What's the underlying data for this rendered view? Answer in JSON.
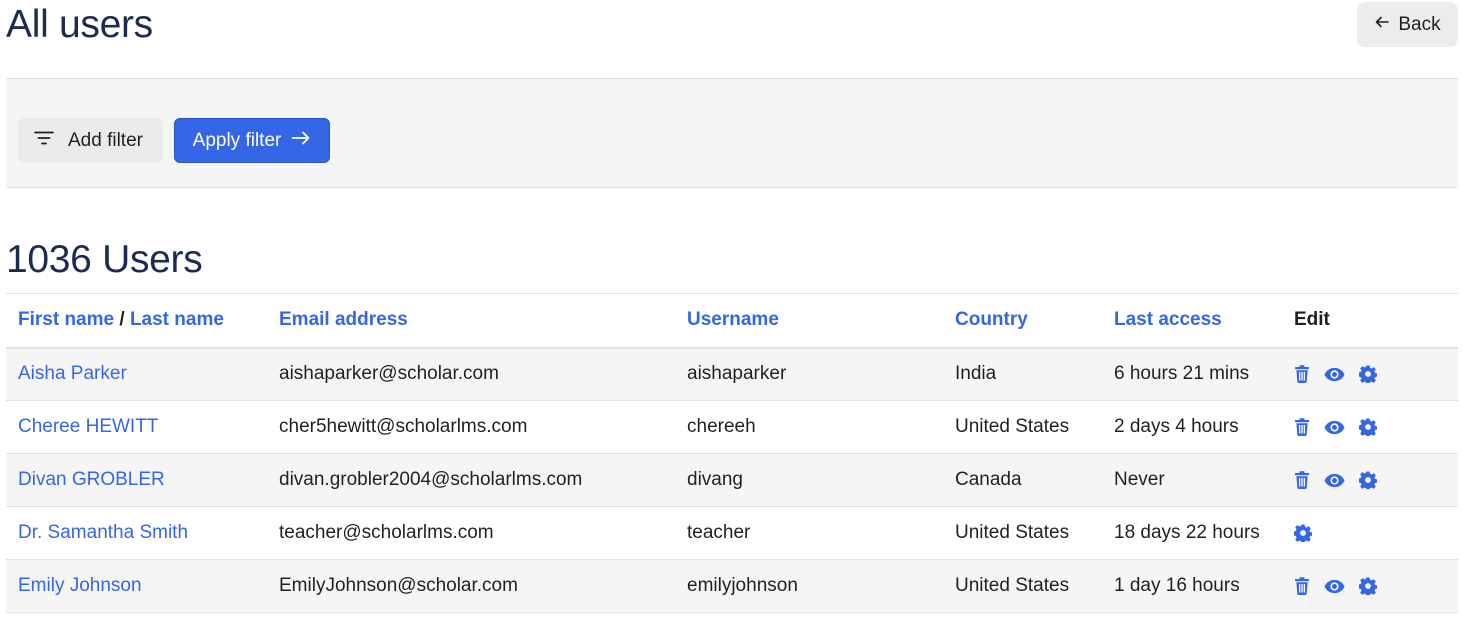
{
  "page_title": "All users",
  "back_label": "Back",
  "filter": {
    "add_label": "Add filter",
    "apply_label": "Apply filter"
  },
  "count_title": "1036 Users",
  "table": {
    "headers": {
      "first_name": "First name",
      "separator": "/",
      "last_name": "Last name",
      "email": "Email address",
      "username": "Username",
      "country": "Country",
      "last_access": "Last access",
      "edit": "Edit"
    },
    "rows": [
      {
        "name": "Aisha Parker",
        "email": "aishaparker@scholar.com",
        "username": "aishaparker",
        "country": "India",
        "last_access": "6 hours 21 mins",
        "actions": [
          "trash-icon",
          "eye-icon",
          "gear-icon"
        ]
      },
      {
        "name": "Cheree HEWITT",
        "email": "cher5hewitt@scholarlms.com",
        "username": "chereeh",
        "country": "United States",
        "last_access": "2 days 4 hours",
        "actions": [
          "trash-icon",
          "eye-icon",
          "gear-icon"
        ]
      },
      {
        "name": "Divan GROBLER",
        "email": "divan.grobler2004@scholarlms.com",
        "username": "divang",
        "country": "Canada",
        "last_access": "Never",
        "actions": [
          "trash-icon",
          "eye-icon",
          "gear-icon"
        ]
      },
      {
        "name": "Dr. Samantha Smith",
        "email": "teacher@scholarlms.com",
        "username": "teacher",
        "country": "United States",
        "last_access": "18 days 22 hours",
        "actions": [
          "gear-icon"
        ]
      },
      {
        "name": "Emily Johnson",
        "email": "EmilyJohnson@scholar.com",
        "username": "emilyjohnson",
        "country": "United States",
        "last_access": "1 day 16 hours",
        "actions": [
          "trash-icon",
          "eye-icon",
          "gear-icon"
        ]
      }
    ]
  },
  "colors": {
    "accent": "#3566e6",
    "title": "#1d2b4f",
    "panel_bg": "#f5f5f5"
  }
}
